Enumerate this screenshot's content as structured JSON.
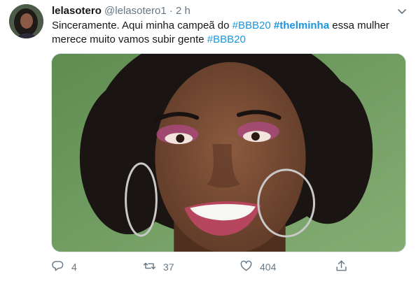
{
  "tweet": {
    "author_name": "lelasotero",
    "author_handle": "@lelasotero1",
    "separator": "·",
    "time": "2 h",
    "text_parts": {
      "p1": "Sinceramente. Aqui minha campeã do ",
      "tag1": "#BBB20",
      "space1": " ",
      "tag2": "#thelminha",
      "p2": " essa mulher merece muito vamos subir gente ",
      "tag3": "#BBB20"
    }
  },
  "actions": {
    "reply_count": "4",
    "retweet_count": "37",
    "like_count": "404"
  },
  "icons": {
    "menu": "chevron-down-icon",
    "reply": "reply-icon",
    "retweet": "retweet-icon",
    "like": "heart-icon",
    "share": "share-icon"
  },
  "colors": {
    "link": "#1b95e0",
    "muted": "#657786"
  }
}
